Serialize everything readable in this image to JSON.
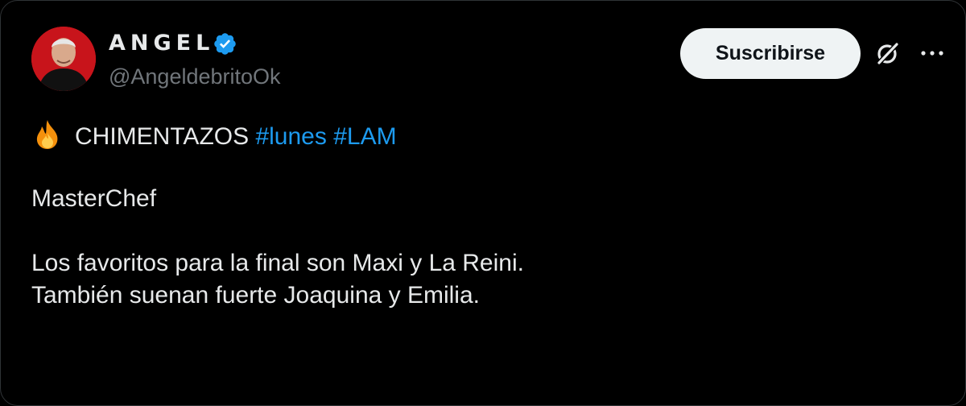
{
  "author": {
    "display_name": "ANGEL",
    "handle": "@AngeldebritoOk",
    "verified": true
  },
  "actions": {
    "subscribe_label": "Suscribirse",
    "grok_icon": "grok-icon",
    "more_icon": "more-icon"
  },
  "tweet": {
    "lead_emoji": "fire",
    "headline": "CHIMENTAZOS",
    "hashtags": [
      "#lunes",
      "#LAM"
    ],
    "paragraph_1": "MasterChef",
    "paragraph_2_line_1": "Los favoritos para la final son Maxi y La Reini.",
    "paragraph_2_line_2": "También suenan fuerte Joaquina y Emilia."
  },
  "colors": {
    "background": "#000000",
    "text": "#e7e9ea",
    "muted": "#71767b",
    "link": "#1d9bf0",
    "verified_badge": "#1d9bf0",
    "button_bg": "#eff3f4",
    "avatar_bg": "#c8141b"
  }
}
